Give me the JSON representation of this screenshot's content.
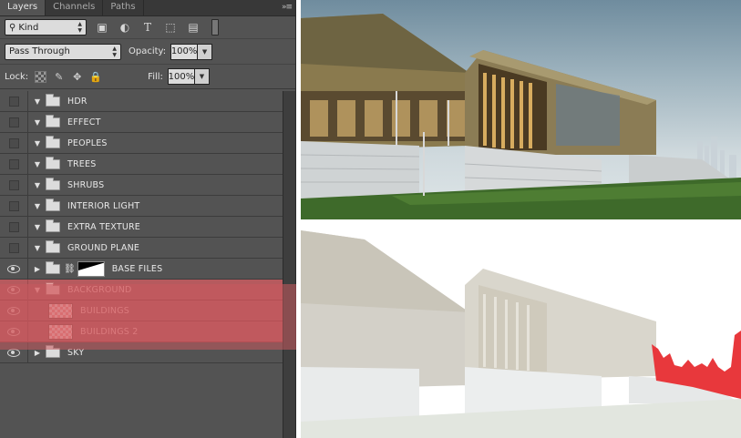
{
  "tabs": [
    {
      "label": "Layers",
      "active": true
    },
    {
      "label": "Channels",
      "active": false
    },
    {
      "label": "Paths",
      "active": false
    }
  ],
  "filter": {
    "kind_label": "Kind",
    "icons": [
      "image-filter-icon",
      "adjustment-filter-icon",
      "type-filter-icon",
      "shape-filter-icon",
      "smart-object-filter-icon"
    ]
  },
  "blend": {
    "mode": "Pass Through",
    "opacity_label": "Opacity:",
    "opacity_value": "100%"
  },
  "lock": {
    "label": "Lock:",
    "fill_label": "Fill:",
    "fill_value": "100%"
  },
  "layers": [
    {
      "name": "HDR",
      "type": "group",
      "visible": false,
      "expanded": true
    },
    {
      "name": "EFFECT",
      "type": "group",
      "visible": false,
      "expanded": true
    },
    {
      "name": "PEOPLES",
      "type": "group",
      "visible": false,
      "expanded": true
    },
    {
      "name": "TREES",
      "type": "group",
      "visible": false,
      "expanded": true
    },
    {
      "name": "SHRUBS",
      "type": "group",
      "visible": false,
      "expanded": true
    },
    {
      "name": "INTERIOR LIGHT",
      "type": "group",
      "visible": false,
      "expanded": true
    },
    {
      "name": "EXTRA TEXTURE",
      "type": "group",
      "visible": false,
      "expanded": true
    },
    {
      "name": "GROUND PLANE",
      "type": "group",
      "visible": false,
      "expanded": true
    },
    {
      "name": "BASE FILES",
      "type": "group-mask",
      "visible": true,
      "expanded": false
    },
    {
      "name": "BACKGROUND",
      "type": "group",
      "visible": true,
      "expanded": true,
      "selected": true
    },
    {
      "name": "BUILDINGS",
      "type": "raster",
      "visible": true,
      "selected": true
    },
    {
      "name": "BUILDINGS 2",
      "type": "raster",
      "visible": true,
      "selected": true
    },
    {
      "name": "SKY",
      "type": "group",
      "visible": true,
      "expanded": false
    }
  ],
  "colors": {
    "panel_bg": "#535353",
    "selection": "#b65a5e",
    "sky_mask": "#e8383c"
  }
}
